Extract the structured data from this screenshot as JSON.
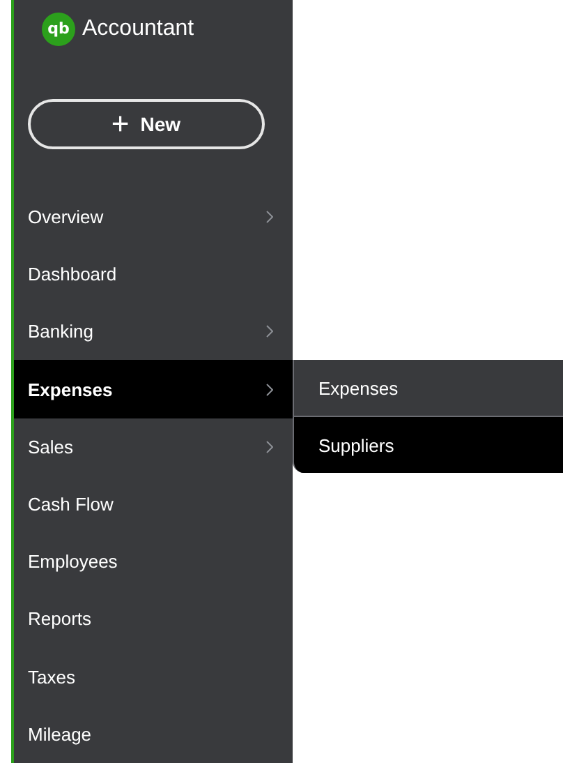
{
  "logo": {
    "text": "Accountant",
    "mark": "qb"
  },
  "new_button": {
    "label": "New",
    "icon": "+"
  },
  "nav": [
    {
      "label": "Overview",
      "expandable": true,
      "selected": false
    },
    {
      "label": "Dashboard",
      "expandable": false,
      "selected": false
    },
    {
      "label": "Banking",
      "expandable": true,
      "selected": false
    },
    {
      "label": "Expenses",
      "expandable": true,
      "selected": true
    },
    {
      "label": "Sales",
      "expandable": true,
      "selected": false
    },
    {
      "label": "Cash Flow",
      "expandable": false,
      "selected": false
    },
    {
      "label": "Employees",
      "expandable": false,
      "selected": false
    },
    {
      "label": "Reports",
      "expandable": false,
      "selected": false
    },
    {
      "label": "Taxes",
      "expandable": false,
      "selected": false
    },
    {
      "label": "Mileage",
      "expandable": false,
      "selected": false
    }
  ],
  "submenu": [
    {
      "label": "Expenses",
      "selected": false
    },
    {
      "label": "Suppliers",
      "selected": true
    }
  ]
}
